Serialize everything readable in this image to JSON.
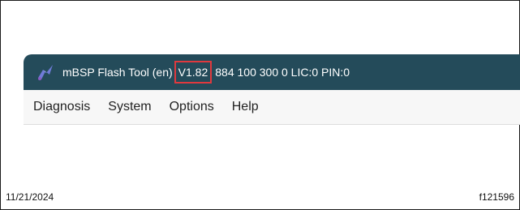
{
  "window": {
    "title_name": "mBSP Flash Tool (en)",
    "version": "V1.82",
    "title_suffix": "884 100 300 0  LIC:0 PIN:0",
    "icon": "flash-tool-app-icon"
  },
  "menu": {
    "items": [
      {
        "label": "Diagnosis"
      },
      {
        "label": "System"
      },
      {
        "label": "Options"
      },
      {
        "label": "Help"
      }
    ]
  },
  "footer": {
    "date": "11/21/2024",
    "figure_id": "f121596"
  },
  "colors": {
    "titlebar": "#244b5a",
    "highlight_box": "#e0393e",
    "menubar": "#f7f7f7"
  }
}
